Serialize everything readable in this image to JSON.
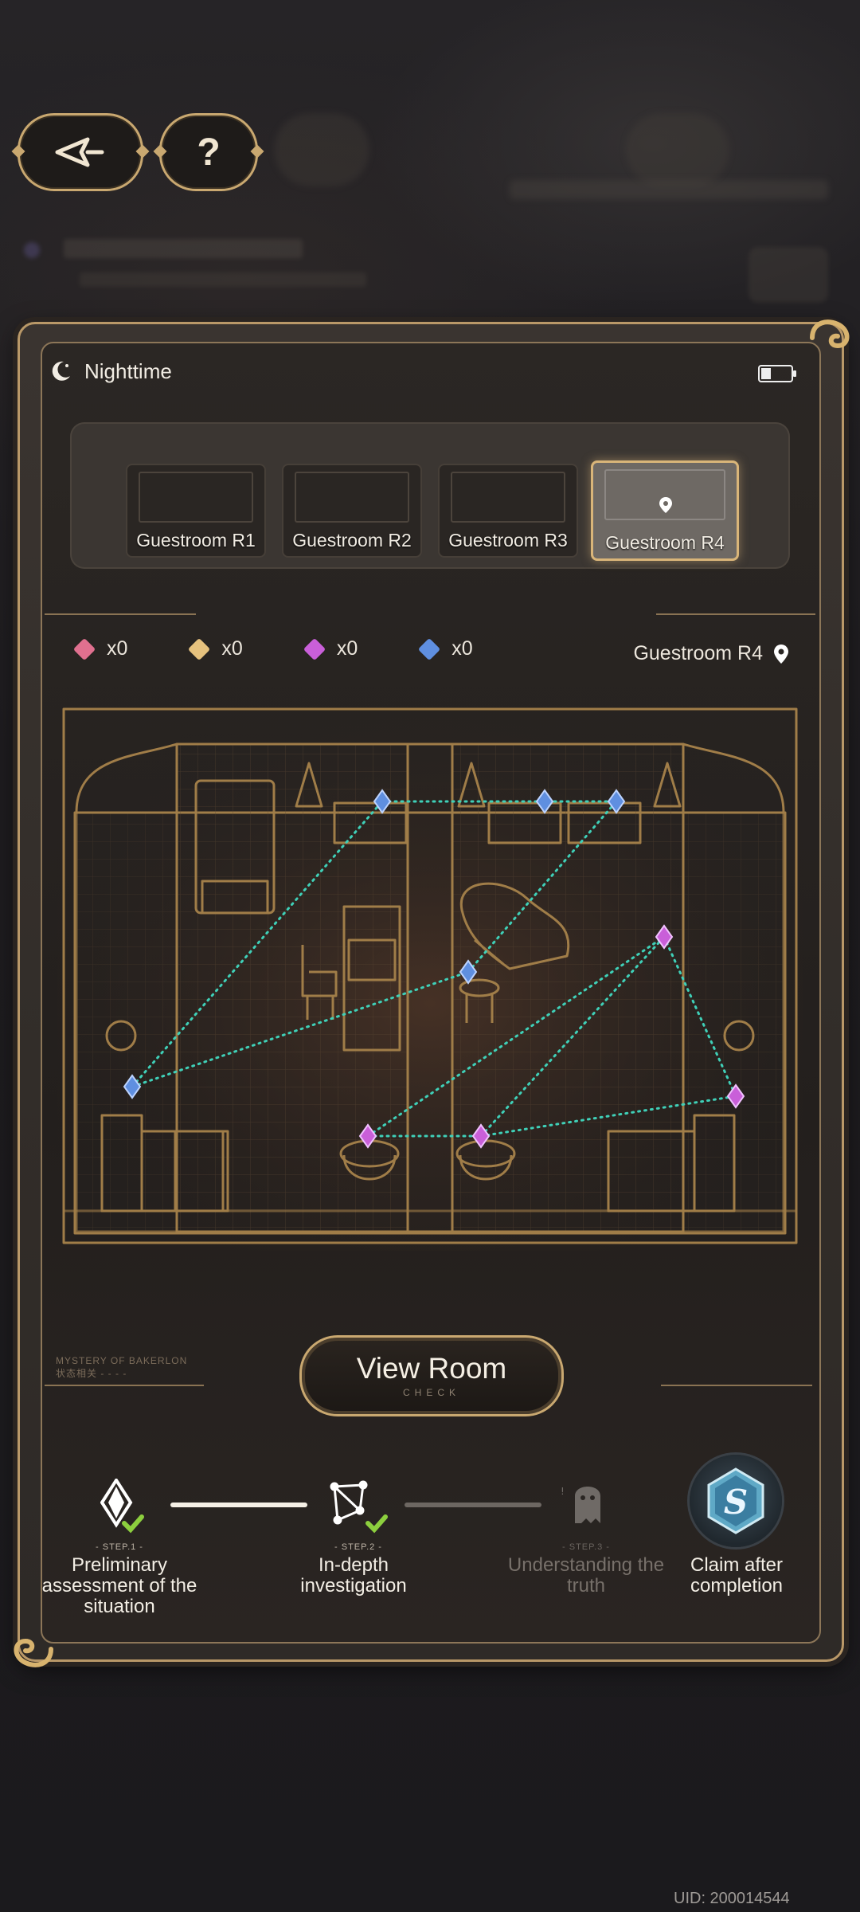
{
  "top_buttons": {
    "back_label": "back",
    "help_label": "?"
  },
  "status": {
    "time_of_day": "Nighttime"
  },
  "rooms": [
    {
      "label": "Guestroom R1",
      "active": false
    },
    {
      "label": "Guestroom R2",
      "active": false
    },
    {
      "label": "Guestroom R3",
      "active": false
    },
    {
      "label": "Guestroom R4",
      "active": true
    }
  ],
  "counters": [
    {
      "color": "#e0708f",
      "value": "x0"
    },
    {
      "color": "#e6c27e",
      "value": "x0"
    },
    {
      "color": "#c95fd9",
      "value": "x0"
    },
    {
      "color": "#5f8fe0",
      "value": "x0"
    }
  ],
  "current_location": "Guestroom R4",
  "view_button": {
    "label": "View Room",
    "sub": "CHECK"
  },
  "mystery_caption": {
    "line1": "MYSTERY OF BAKERLON",
    "line2": "状态相关 - - - -"
  },
  "steps": [
    {
      "cap": "- STEP.1 -",
      "text": "Preliminary assessment of the situation",
      "done": true
    },
    {
      "cap": "- STEP.2 -",
      "text": "In-depth investigation",
      "done": true
    },
    {
      "cap": "- STEP.3 -",
      "text": "Understanding the truth",
      "done": false
    }
  ],
  "reward": {
    "label": "Claim after completion",
    "letter": "S"
  },
  "uid": "UID: 200014544",
  "colors": {
    "accent_gold": "#c9a870",
    "cyan_path": "#3fd0b8",
    "check_green": "#8ccf3e"
  }
}
